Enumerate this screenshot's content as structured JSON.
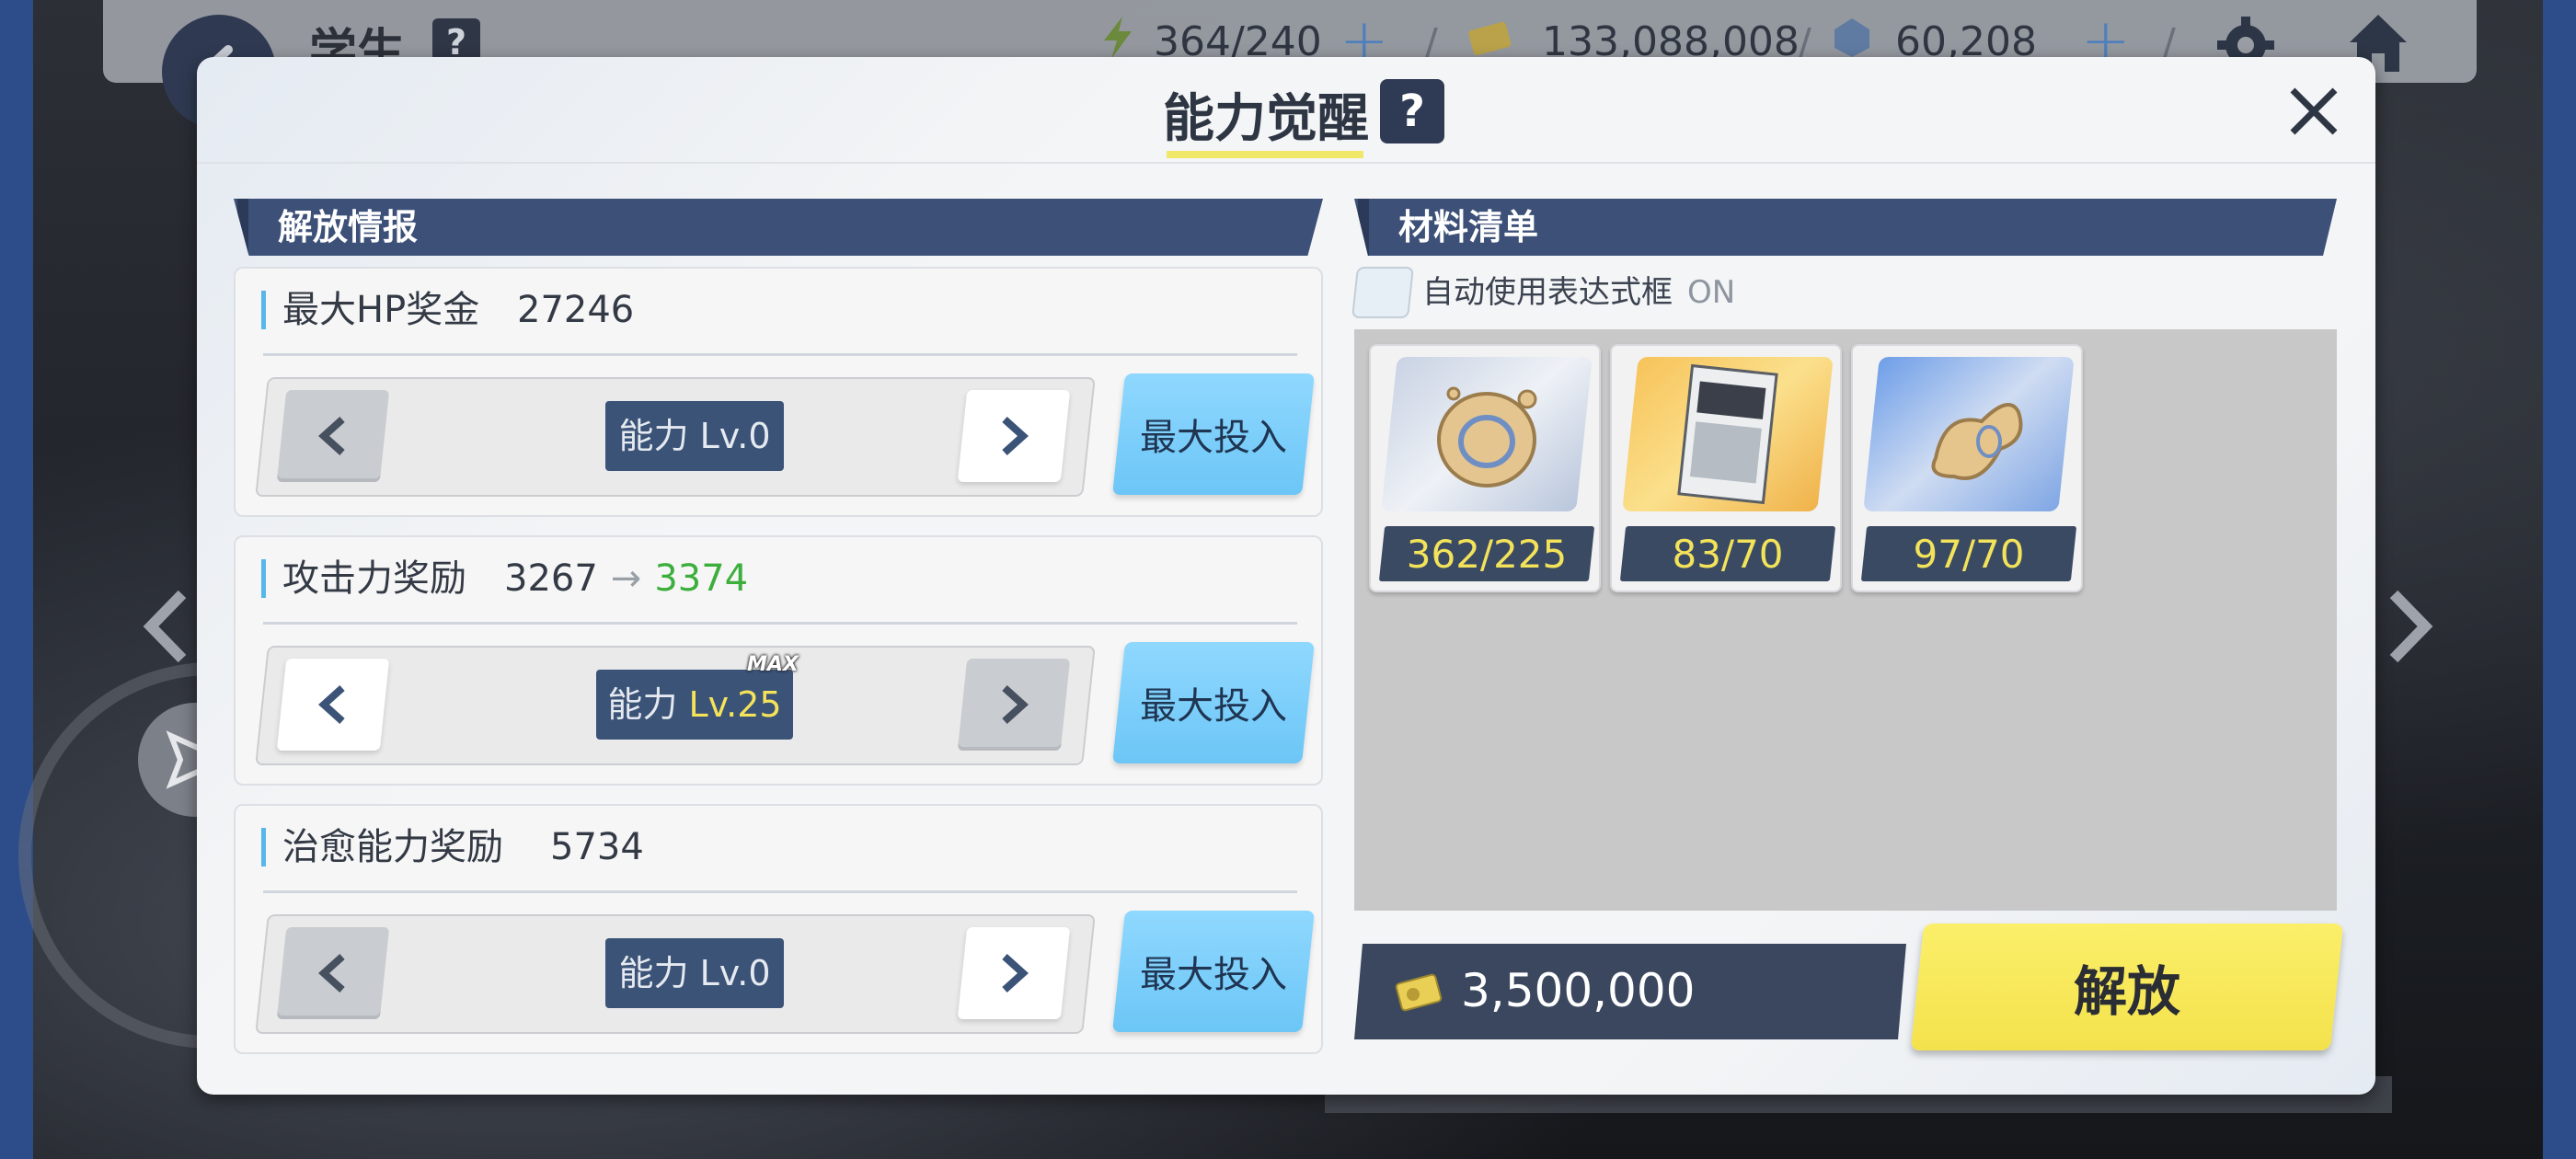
{
  "topbar": {
    "title": "学生",
    "help": "?",
    "ap": "364/240",
    "credits": "133,088,008",
    "gems": "60,208"
  },
  "dialog": {
    "title": "能力觉醒",
    "help": "?",
    "left_header": "解放情报",
    "right_header": "材料清单"
  },
  "stats": [
    {
      "label": "最大HP奖金",
      "value": "27246",
      "next": "",
      "level_prefix": "能力",
      "level": "Lv.0",
      "max_tag": "",
      "invest_label": "最大投入"
    },
    {
      "label": "攻击力奖励",
      "value": "3267",
      "next": "3374",
      "level_prefix": "能力",
      "level": "Lv.25",
      "max_tag": "MAX",
      "invest_label": "最大投入"
    },
    {
      "label": "治愈能力奖励",
      "value": "5734",
      "next": "",
      "level_prefix": "能力",
      "level": "Lv.0",
      "max_tag": "",
      "invest_label": "最大投入"
    }
  ],
  "materials": {
    "auto_label": "自动使用表达式框",
    "auto_state": "ON",
    "items": [
      {
        "icon": "artifact-ring-icon",
        "count": "362/225"
      },
      {
        "icon": "firearms-training-book-icon",
        "count": "83/70"
      },
      {
        "icon": "artifact-shard-icon",
        "count": "97/70"
      }
    ]
  },
  "cost": {
    "value": "3,500,000",
    "icon": "credit-icon"
  },
  "release_label": "解放",
  "colors": {
    "accent_blue": "#3b5377",
    "green_value": "#3cae3c",
    "count_yellow": "#f3e35a",
    "release_yellow": "#f4e24c",
    "invest_blue": "#6cc6f6"
  }
}
